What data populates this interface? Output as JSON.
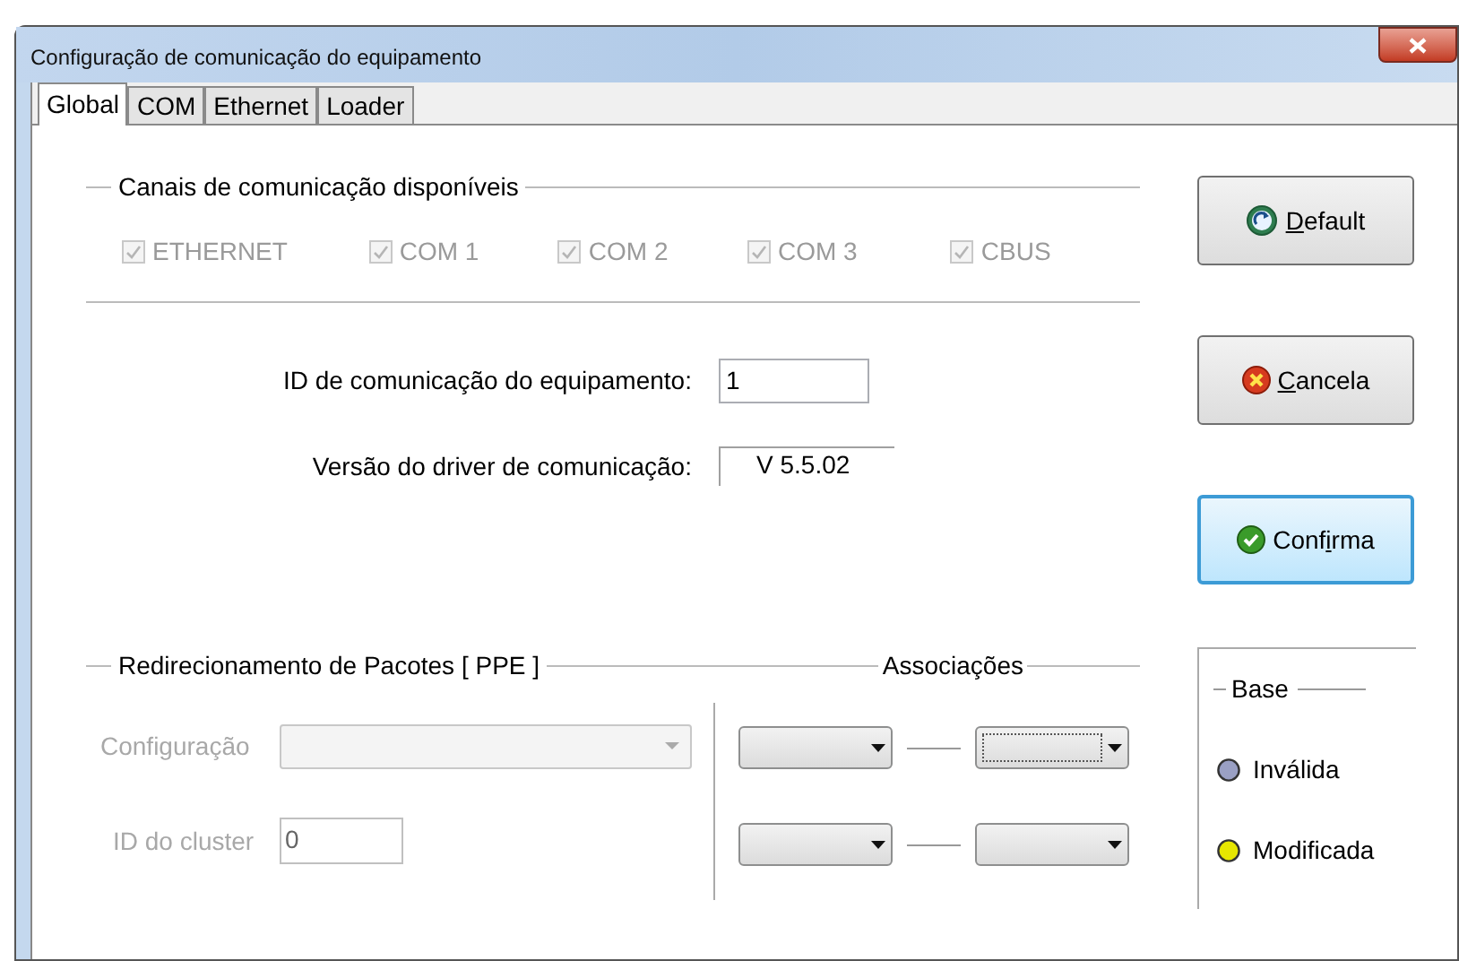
{
  "window": {
    "title": "Configuração de comunicação do equipamento"
  },
  "tabs": [
    {
      "label": "Global",
      "selected": true
    },
    {
      "label": "COM",
      "selected": false
    },
    {
      "label": "Ethernet",
      "selected": false
    },
    {
      "label": "Loader",
      "selected": false
    }
  ],
  "channels": {
    "title": "Canais de comunicação disponíveis",
    "items": [
      {
        "label": "ETHERNET",
        "checked": true,
        "disabled": true
      },
      {
        "label": "COM 1",
        "checked": true,
        "disabled": true
      },
      {
        "label": "COM 2",
        "checked": true,
        "disabled": true
      },
      {
        "label": "COM 3",
        "checked": true,
        "disabled": true
      },
      {
        "label": "CBUS",
        "checked": true,
        "disabled": true
      }
    ]
  },
  "device_id": {
    "label": "ID de comunicação do equipamento:",
    "value": "1"
  },
  "driver_version": {
    "label": "Versão do driver de comunicação:",
    "value": "V 5.5.02"
  },
  "redirect": {
    "title": "Redirecionamento de Pacotes [ PPE ]",
    "associations_title": "Associações",
    "configuration": {
      "label": "Configuração",
      "disabled": true
    },
    "cluster": {
      "label": "ID do cluster",
      "value": "0",
      "disabled": true
    },
    "associations": [
      {
        "left_focused": false,
        "right_focused": true
      },
      {
        "left_focused": false,
        "right_focused": false
      }
    ]
  },
  "buttons": [
    {
      "kind": "default",
      "accel": "D",
      "after": "efault",
      "focused": false
    },
    {
      "kind": "cancel",
      "accel": "C",
      "after": "ancela",
      "focused": false
    },
    {
      "kind": "confirm",
      "before": "Conf",
      "accel": "i",
      "after": "rma",
      "focused": true
    }
  ],
  "base": {
    "title": "Base",
    "items": [
      {
        "label": "Inválida",
        "color": "#9aa0c4"
      },
      {
        "label": "Modificada",
        "color": "#e6e600"
      }
    ]
  }
}
